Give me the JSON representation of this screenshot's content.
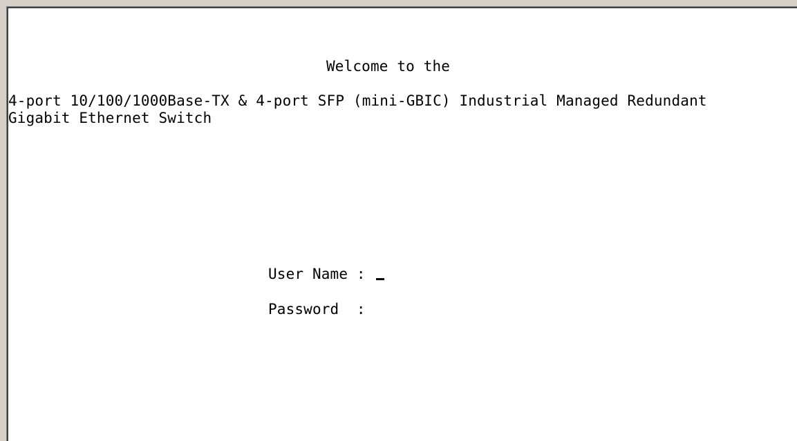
{
  "terminal": {
    "welcome": "Welcome to the",
    "product_line1": "4-port 10/100/1000Base-TX & 4-port SFP (mini-GBIC) Industrial Managed Redundant",
    "product_line2": "Gigabit Ethernet Switch",
    "login": {
      "username_label": "User Name : ",
      "username_value": "",
      "password_label": "Password  :",
      "password_value": ""
    }
  },
  "colors": {
    "background": "#ffffff",
    "text": "#000000",
    "window_frame": "#d4d0c8"
  }
}
